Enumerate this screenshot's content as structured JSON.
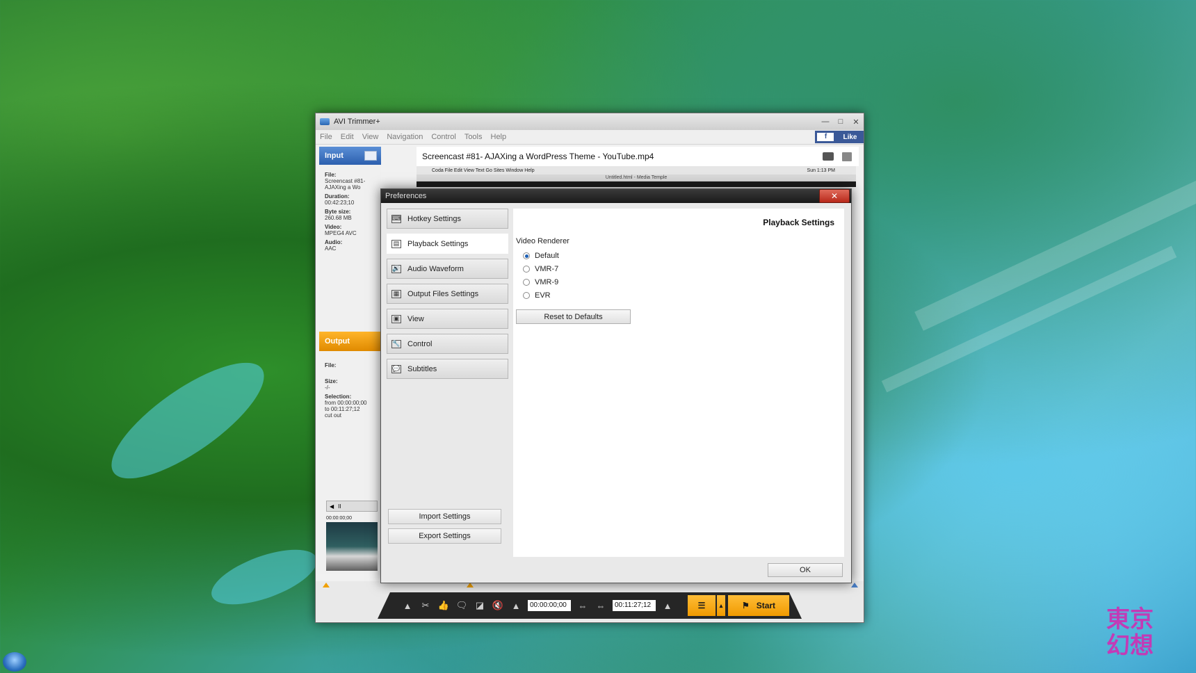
{
  "app": {
    "title": "AVI Trimmer+",
    "menu": [
      "File",
      "Edit",
      "View",
      "Navigation",
      "Control",
      "Tools",
      "Help"
    ],
    "like_label": "Like",
    "fb_glyph": "f"
  },
  "input_panel": {
    "header": "Input",
    "file_label": "File:",
    "file_value": "Screencast #81- AJAXing a Wo",
    "duration_label": "Duration:",
    "duration_value": "00:42:23;10",
    "bytesize_label": "Byte size:",
    "bytesize_value": "260.68 MB",
    "video_label": "Video:",
    "video_value": "MPEG4 AVC",
    "audio_label": "Audio:",
    "audio_value": "AAC"
  },
  "output_panel": {
    "header": "Output",
    "file_label": "File:",
    "size_label": "Size:",
    "size_value": "-/-",
    "selection_label": "Selection:",
    "selection_from": "from  00:00:00;00",
    "selection_to": "to      00:11:27;12",
    "selection_note": "cut out"
  },
  "video": {
    "title": "Screencast #81- AJAXing a WordPress Theme - YouTube.mp4",
    "mac_menu": "Coda   File   Edit   View   Text   Go   Sites   Window   Help",
    "mac_clock": "Sun 1:13 PM",
    "mac_doc": "Untitled.html - Media Temple"
  },
  "thumb": {
    "time": "00:00:00;00",
    "pause_glyph": "II",
    "prev_glyph": "◀"
  },
  "controls": {
    "start_time": "00:00:00;00",
    "end_time": "00:11:27;12",
    "start_label": "Start",
    "icons": {
      "eject": "▲",
      "cut": "✂",
      "like": "👍",
      "dislike": "🗨",
      "frame": "◪",
      "mute": "🔇",
      "step": "⇔",
      "flag": "⚑",
      "list": "☰",
      "chev": "▴"
    }
  },
  "prefs": {
    "title": "Preferences",
    "close_glyph": "✕",
    "nav": [
      {
        "label": "Hotkey Settings",
        "icon": "⌨"
      },
      {
        "label": "Playback Settings",
        "icon": "▤"
      },
      {
        "label": "Audio Waveform",
        "icon": "🔊"
      },
      {
        "label": "Output Files Settings",
        "icon": "▦"
      },
      {
        "label": "View",
        "icon": "▣"
      },
      {
        "label": "Control",
        "icon": "🔧"
      },
      {
        "label": "Subtitles",
        "icon": "💬"
      }
    ],
    "import_label": "Import Settings",
    "export_label": "Export Settings",
    "content_title": "Playback Settings",
    "section_label": "Video Renderer",
    "renderers": [
      "Default",
      "VMR-7",
      "VMR-9",
      "EVR"
    ],
    "selected_renderer": "Default",
    "reset_label": "Reset to Defaults",
    "ok_label": "OK"
  },
  "watermark": "東京\n幻想"
}
